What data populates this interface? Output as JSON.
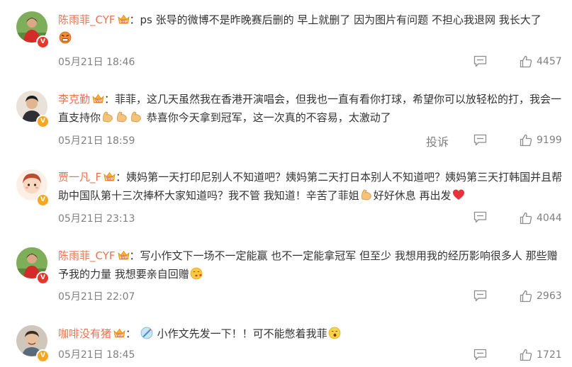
{
  "comments": [
    {
      "user": "陈雨菲_CYF",
      "sep": "：",
      "text_a": "ps 张导的微博不是昨晚赛后删的 早上就删了 因为图片有问题 不担心我退网 我长大了",
      "emoji_end": "angry-face-emoji",
      "time": "05月21日 18:46",
      "likes": "4457",
      "badge": "red",
      "report": ""
    },
    {
      "user": "李克勤",
      "sep": "：",
      "text_a": "菲菲，这几天虽然我在香港开演唱会，但我也一直有看你打球，希望你可以放轻松的打，我会一直支持你",
      "text_b": " 恭喜你今天拿到冠军，这一次真的不容易，太激动了",
      "emoji_mid": "flexed-biceps-emoji",
      "time": "05月21日 18:59",
      "likes": "9199",
      "badge": "gold",
      "report": "投诉"
    },
    {
      "user": "贾一凡_F",
      "sep": "：",
      "text_a": "姨妈第一天打印尼别人不知道吧？姨妈第二天打日本别人不知道吧？姨妈第三天打韩国并且帮助中国队第十三次捧杯大家知道吗？我不管 我知道！辛苦了菲姐",
      "text_b": "好好休息 再出发",
      "emoji_mid": "flexed-biceps-emoji",
      "emoji_end": "red-heart-emoji",
      "time": "05月21日 23:13",
      "likes": "4044",
      "badge": "gold",
      "report": ""
    },
    {
      "user": "陈雨菲_CYF",
      "sep": "：",
      "text_a": "写小作文下一场不一定能赢 也不一定能拿冠军 但至少 我想用我的经历影响很多人 那些赠予我的力量 我想要亲自回赠",
      "emoji_end": "face-blowing-kiss-emoji",
      "time": "05月21日 22:07",
      "likes": "2963",
      "badge": "red",
      "report": ""
    },
    {
      "user": "咖啡没有猪",
      "sep": "：",
      "text_a": "小作文先发一下！！可不能憋着我菲",
      "emoji_start": "writing-emoji",
      "emoji_end": "yawning-emoji",
      "time": "05月21日 18:45",
      "likes": "1721",
      "badge": "gold",
      "report": ""
    }
  ],
  "colors": {
    "username": "#eb7350",
    "text": "#333333",
    "meta": "#808080"
  }
}
